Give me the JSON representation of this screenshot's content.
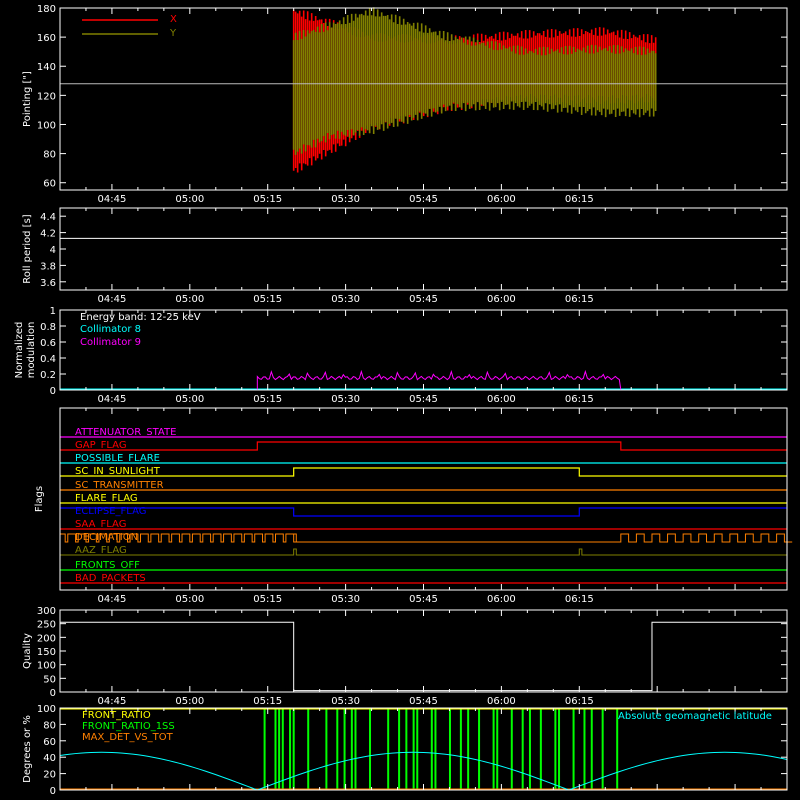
{
  "time_ticks": [
    "04:45",
    "05:00",
    "05:15",
    "05:30",
    "05:45",
    "06:00",
    "06:15"
  ],
  "colors": {
    "pointing_x": "#ff0000",
    "pointing_y": "#808000",
    "collimator_8": "#00ffff",
    "collimator_9": "#ff00ff",
    "front_ratio": "#ffff00",
    "front_ratio_1ss": "#00ff00",
    "max_det_vs_tot": "#ff8000",
    "geomag": "#00ffff"
  },
  "chart_data": [
    {
      "type": "line",
      "ylabel": "Pointing [\"]",
      "ylim": [
        55,
        180
      ],
      "yticks": [
        60,
        80,
        100,
        120,
        140,
        160,
        180
      ],
      "xlim_min": [
        0,
        100
      ],
      "series": [
        {
          "name": "X",
          "envelope": [
            [
              45,
              178,
              68,
              128,
              140
            ],
            [
              60,
              160,
              98,
              134,
              150
            ],
            [
              75,
              158,
              112,
              130,
              155
            ],
            [
              90,
              162,
              118,
              128,
              158
            ],
            [
              105,
              164,
              117,
              130,
              160
            ],
            [
              115,
              158,
              118,
              128,
              158
            ]
          ]
        },
        {
          "name": "Y",
          "envelope": [
            [
              45,
              160,
              80,
              128,
              140
            ],
            [
              52,
              168,
              92,
              130,
              150
            ],
            [
              60,
              178,
              96,
              129,
              155
            ],
            [
              75,
              160,
              112,
              128,
              156
            ],
            [
              90,
              150,
              113,
              129,
              150
            ],
            [
              105,
              152,
              108,
              130,
              152
            ],
            [
              115,
              150,
              108,
              130,
              150
            ]
          ]
        }
      ],
      "reference_line": 128,
      "legend": "top-left"
    },
    {
      "type": "line",
      "ylabel": "Roll period [s]",
      "ylim": [
        3.5,
        4.5
      ],
      "yticks": [
        3.6,
        3.8,
        4.0,
        4.2,
        4.4
      ],
      "series": [
        {
          "name": "",
          "x": [
            0,
            100
          ],
          "y": [
            4.13,
            4.13
          ]
        }
      ]
    },
    {
      "type": "line",
      "ylabel": "Normalized modulation",
      "ylim": [
        0,
        1.0
      ],
      "yticks": [
        0.0,
        0.2,
        0.4,
        0.6,
        0.8,
        1.0
      ],
      "annotation": "Energy band: 12-25 keV",
      "series": [
        {
          "name": "Collimator 8",
          "x": [
            0,
            100
          ],
          "y": [
            0,
            0
          ]
        },
        {
          "name": "Collimator 9",
          "x": [
            0,
            38,
            38,
            108,
            108,
            140
          ],
          "y": [
            0,
            0,
            0.15,
            0.15,
            0,
            0
          ]
        }
      ]
    },
    {
      "type": "flags",
      "ylabel": "Flags",
      "flags": [
        {
          "name": "ATTENUATOR_STATE",
          "color": "#ff00ff"
        },
        {
          "name": "GAP_FLAG",
          "color": "#ff0000"
        },
        {
          "name": "POSSIBLE_FLARE",
          "color": "#00ffff"
        },
        {
          "name": "SC_IN_SUNLIGHT",
          "color": "#ffff00"
        },
        {
          "name": "SC_TRANSMITTER",
          "color": "#ff8000"
        },
        {
          "name": "FLARE_FLAG",
          "color": "#ffff00"
        },
        {
          "name": "ECLIPSE_FLAG",
          "color": "#0000ff"
        },
        {
          "name": "SAA_FLAG",
          "color": "#ff0000"
        },
        {
          "name": "DECIMATION",
          "color": "#ff8000"
        },
        {
          "name": "AAZ_FLAG",
          "color": "#808000"
        },
        {
          "name": "FRONTS_OFF",
          "color": "#00ff00"
        },
        {
          "name": "BAD_PACKETS",
          "color": "#ff0000"
        }
      ]
    },
    {
      "type": "line",
      "ylabel": "Quality",
      "ylim": [
        0,
        300
      ],
      "yticks": [
        0,
        50,
        100,
        150,
        200,
        250,
        300
      ],
      "series": [
        {
          "name": "",
          "x": [
            0,
            45,
            45,
            114,
            114,
            140
          ],
          "y": [
            255,
            255,
            5,
            5,
            255,
            255
          ]
        }
      ]
    },
    {
      "type": "line",
      "ylabel": "Degrees or %",
      "ylim": [
        0,
        100
      ],
      "yticks": [
        0,
        20,
        40,
        60,
        80,
        100
      ],
      "series": [
        {
          "name": "FRONT_RATIO",
          "x": [
            0,
            140
          ],
          "y": [
            100,
            100
          ]
        },
        {
          "name": "FRONT_RATIO_1SS",
          "x": [
            0,
            140
          ],
          "y": [
            100,
            100
          ]
        },
        {
          "name": "MAX_DET_VS_TOT",
          "x": [
            0,
            140
          ],
          "y": [
            0,
            0
          ]
        },
        {
          "name": "Absolute geomagnetic latitude",
          "x": [
            0,
            10,
            20,
            30,
            40,
            50,
            60,
            70,
            80,
            90,
            100,
            110,
            120,
            130,
            140
          ],
          "y": [
            37,
            46,
            40,
            22,
            2,
            18,
            35,
            46,
            38,
            20,
            2,
            18,
            35,
            44,
            38
          ]
        }
      ]
    }
  ]
}
